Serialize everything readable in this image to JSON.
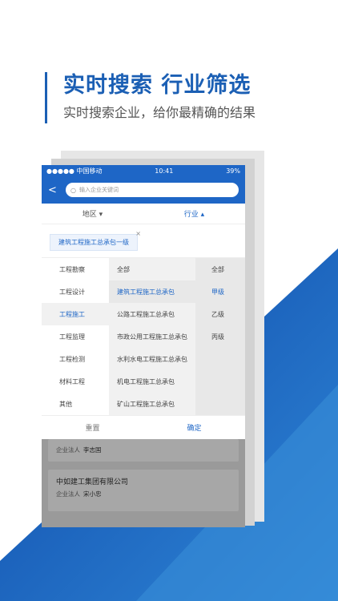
{
  "hero": {
    "title": "实时搜索 行业筛选",
    "subtitle": "实时搜索企业，给你最精确的结果"
  },
  "status_bar": {
    "carrier": "●●●●● 中国移动",
    "time": "10:41",
    "battery": "39%"
  },
  "search": {
    "placeholder": "输入企业关键词"
  },
  "filters": {
    "region": "地区 ▾",
    "industry": "行业 ▴"
  },
  "selected_chip": "建筑工程施工总承包一级",
  "categories": [
    "工程勘察",
    "工程设计",
    "工程施工",
    "工程监理",
    "工程检测",
    "材料工程",
    "其他"
  ],
  "subcategories": [
    "全部",
    "建筑工程施工总承包",
    "公路工程施工总承包",
    "市政公用工程施工总承包",
    "水利水电工程施工总承包",
    "机电工程施工总承包",
    "矿山工程施工总承包"
  ],
  "grades": [
    "全部",
    "甲级",
    "乙级",
    "丙级"
  ],
  "actions": {
    "reset": "重置",
    "confirm": "确定"
  },
  "cards": [
    {
      "name": "",
      "legal_label": "企业法人",
      "legal_name": "李志国"
    },
    {
      "name": "中如建工集团有限公司",
      "legal_label": "企业法人",
      "legal_name": "宋小忠"
    }
  ],
  "colors": {
    "brand_blue": "#1e66c6",
    "accent_dark_blue": "#0d47a8"
  }
}
